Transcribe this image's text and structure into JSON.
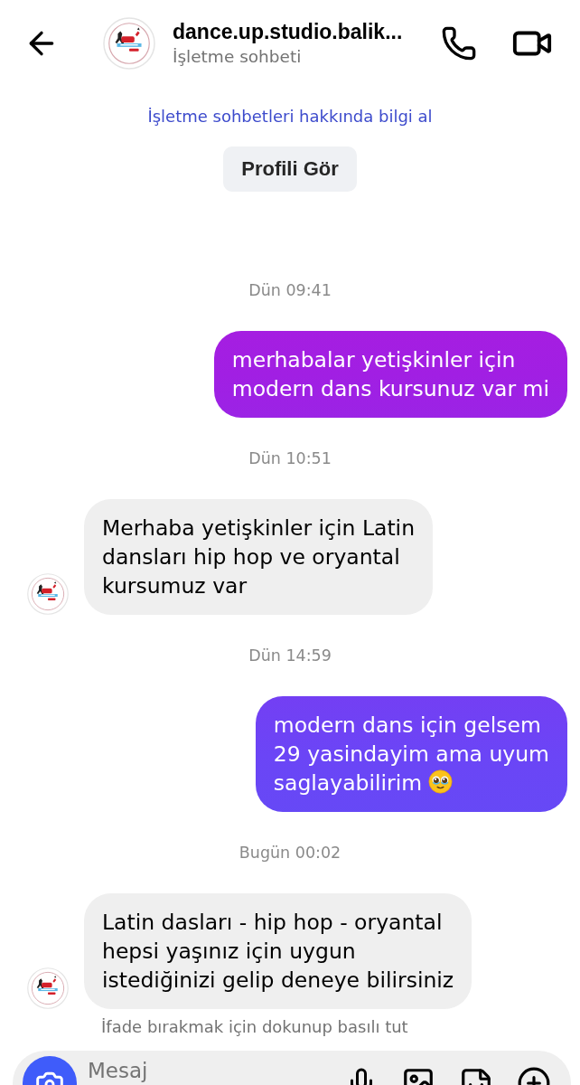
{
  "header": {
    "title": "dance.up.studio.balik...",
    "subtitle": "İşletme sohbeti"
  },
  "intro": {
    "link": "İşletme sohbetleri hakkında bilgi al",
    "profile_button": "Profili Gör"
  },
  "thread": [
    {
      "kind": "timestamp",
      "text": "Dün 09:41"
    },
    {
      "kind": "sent",
      "text": "merhabalar yetişkinler için\nmodern dans kursunuz var mi"
    },
    {
      "kind": "timestamp",
      "text": "Dün 10:51"
    },
    {
      "kind": "received",
      "text": "Merhaba yetişkinler için Latin\ndansları hip hop ve oryantal\nkursumuz var"
    },
    {
      "kind": "timestamp",
      "text": "Dün 14:59"
    },
    {
      "kind": "sent",
      "text": "modern dans için gelsem\n29 yasindayim ama uyum\nsaglayabilirim",
      "emoji": true
    },
    {
      "kind": "timestamp",
      "text": "Bugün 00:02"
    },
    {
      "kind": "received",
      "text": "Latin dasları - hip hop - oryantal\nhepsi yaşınız için uygun\nistediğinizi gelip deneye bilirsiniz"
    }
  ],
  "reaction_hint": "İfade bırakmak için dokunup basılı tut",
  "composer": {
    "placeholder": "Mesaj"
  }
}
